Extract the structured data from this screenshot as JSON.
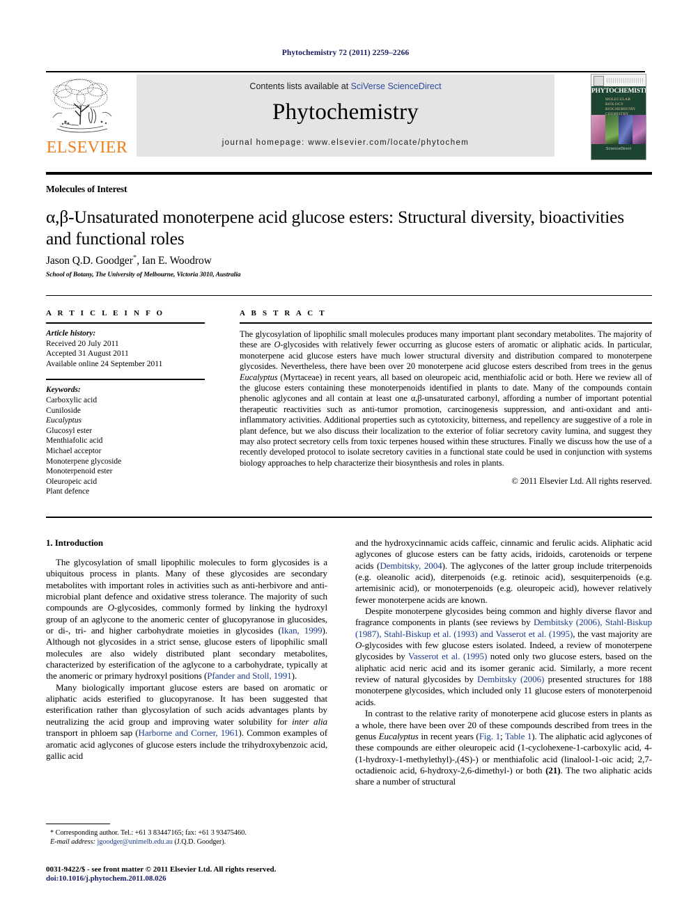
{
  "running_head": "Phytochemistry 72 (2011) 2259–2266",
  "masthead": {
    "publisher_name": "ELSEVIER",
    "contents_prefix": "Contents lists available at ",
    "contents_link": "SciVerse ScienceDirect",
    "journal_title": "Phytochemistry",
    "homepage": "journal homepage: www.elsevier.com/locate/phytochem",
    "cover": {
      "title": "PHYTOCHEMISTRY",
      "subtitle_lines": "MOLECULAR BIOLOGY\nBIOCHEMISTRY\nCHEMISTRY",
      "footer": "ScienceDirect"
    }
  },
  "article": {
    "section_label": "Molecules of Interest",
    "title": "α,β-Unsaturated monoterpene acid glucose esters: Structural diversity, bioactivities and functional roles",
    "authors": "Jason Q.D. Goodger",
    "authors_second": ", Ian E. Woodrow",
    "corresponding_marker": "*",
    "affiliation": "School of Botany, The University of Melbourne, Victoria 3010, Australia"
  },
  "article_info": {
    "heading": "A R T I C L E    I N F O",
    "history_label": "Article history:",
    "history": [
      "Received 20 July 2011",
      "Accepted 31 August 2011",
      "Available online 24 September 2011"
    ],
    "keywords_label": "Keywords:",
    "keywords": [
      "Carboxylic acid",
      "Cuniloside",
      "Eucalyptus",
      "Glucosyl ester",
      "Menthiafolic acid",
      "Michael acceptor",
      "Monoterpene glycoside",
      "Monoterpenoid ester",
      "Oleuropeic acid",
      "Plant defence"
    ],
    "keywords_italic_index": 2
  },
  "abstract": {
    "heading": "A B S T R A C T",
    "body_1": "The glycosylation of lipophilic small molecules produces many important plant secondary metabolites. The majority of these are ",
    "o_gly": "O",
    "body_2": "-glycosides with relatively fewer occurring as glucose esters of aromatic or aliphatic acids. In particular, monoterpene acid glucose esters have much lower structural diversity and distribution compared to monoterpene glycosides. Nevertheless, there have been over 20 monoterpene acid glucose esters described from trees in the genus ",
    "genus": "Eucalyptus",
    "body_3": " (Myrtaceae) in recent years, all based on oleuropeic acid, menthiafolic acid or both. Here we review all of the glucose esters containing these monoterpenoids identified in plants to date. Many of the compounds contain phenolic aglycones and all contain at least one α,β-unsaturated carbonyl, affording a number of important potential therapeutic reactivities such as anti-tumor promotion, carcinogenesis suppression, and anti-oxidant and anti-inflammatory activities. Additional properties such as cytotoxicity, bitterness, and repellency are suggestive of a role in plant defence, but we also discuss their localization to the exterior of foliar secretory cavity lumina, and suggest they may also protect secretory cells from toxic terpenes housed within these structures. Finally we discuss how the use of a recently developed protocol to isolate secretory cavities in a functional state could be used in conjunction with systems biology approaches to help characterize their biosynthesis and roles in plants.",
    "rights": "© 2011 Elsevier Ltd. All rights reserved."
  },
  "introduction": {
    "heading": "1. Introduction",
    "p1_a": "The glycosylation of small lipophilic molecules to form glycosides is a ubiquitous process in plants. Many of these glycosides are secondary metabolites with important roles in activities such as anti-herbivore and anti-microbial plant defence and oxidative stress tolerance. The majority of such compounds are ",
    "p1_o": "O",
    "p1_b": "-glycosides, commonly formed by linking the hydroxyl group of an aglycone to the anomeric center of glucopyranose in glucosides, or di-, tri- and higher carbohydrate moieties in glycosides (",
    "p1_cite1": "Ikan, 1999",
    "p1_c": "). Although not glycosides in a strict sense, glucose esters of lipophilic small molecules are also widely distributed plant secondary metabolites, characterized by esterification of the aglycone to a carbohydrate, typically at the anomeric or primary hydroxyl positions (",
    "p1_cite2": "Pfander and Stoll, 1991",
    "p1_d": ").",
    "p2_a": "Many biologically important glucose esters are based on aromatic or aliphatic acids esterified to glucopyranose. It has been suggested that esterification rather than glycosylation of such acids advantages plants by neutralizing the acid group and improving water solubility for ",
    "p2_italic": "inter alia",
    "p2_b": " transport in phloem sap (",
    "p2_cite1": "Harborne and Corner, 1961",
    "p2_c": "). Common examples of aromatic acid aglycones of glucose esters include the trihydroxybenzoic acid, gallic acid",
    "r1_a": "and the hydroxycinnamic acids caffeic, cinnamic and ferulic acids. Aliphatic acid aglycones of glucose esters can be fatty acids, iridoids, carotenoids or terpene acids (",
    "r1_cite": "Dembitsky, 2004",
    "r1_b": "). The aglycones of the latter group include triterpenoids (e.g. oleanolic acid), diterpenoids (e.g. retinoic acid), sesquiterpenoids (e.g. artemisinic acid), or monoterpenoids (e.g. oleuropeic acid), however relatively fewer monoterpene acids are known.",
    "r2_a": "Despite monoterpene glycosides being common and highly diverse flavor and fragrance components in plants (see reviews by ",
    "r2_cite1": "Dembitsky (2006), Stahl-Biskup (1987), Stahl-Biskup et al. (1993) and Vasserot et al. (1995)",
    "r2_b": ", the vast majority are ",
    "r2_o": "O",
    "r2_c": "-glycosides with few glucose esters isolated. Indeed, a review of monoterpene glycosides by ",
    "r2_cite2": "Vasserot et al. (1995)",
    "r2_d": " noted only two glucose esters, based on the aliphatic acid neric acid and its isomer geranic acid. Similarly, a more recent review of natural glycosides by ",
    "r2_cite3": "Dembitsky (2006)",
    "r2_e": " presented structures for 188 monoterpene glycosides, which included only 11 glucose esters of monoterpenoid acids.",
    "r3_a": "In contrast to the relative rarity of monoterpene acid glucose esters in plants as a whole, there have been over 20 of these compounds described from trees in the genus ",
    "r3_genus": "Eucalyptus",
    "r3_b": " in recent years (",
    "r3_cite1": "Fig. 1",
    "r3_c": "; ",
    "r3_cite2": "Table 1",
    "r3_d": "). The aliphatic acid aglycones of these compounds are either oleuropeic acid (1-cyclohexene-1-carboxylic acid, 4-(1-hydroxy-1-methylethyl)-,(4S)-) or menthiafolic acid (linalool-1-oic acid; 2,7-octadienoic acid, 6-hydroxy-2,6-dimethyl-) or both ",
    "r3_bold": "(21)",
    "r3_e": ". The two aliphatic acids share a number of structural"
  },
  "footnote": {
    "marker": "*",
    "corresponding": " Corresponding author. Tel.: +61 3 83447165; fax: +61 3 93475460.",
    "email_label": "E-mail address:",
    "email": "jgoodger@unimelb.edu.au",
    "email_suffix": " (J.Q.D. Goodger)."
  },
  "page_footer": {
    "issn_line": "0031-9422/$ - see front matter © 2011 Elsevier Ltd. All rights reserved.",
    "doi_prefix": "doi:",
    "doi": "10.1016/j.phytochem.2011.08.026"
  },
  "colors": {
    "link_blue": "#2b4a9b",
    "cite_blue": "#1a3a8f",
    "elsevier_orange": "#f07d1a",
    "cover_green": "#1d4430",
    "band_gray": "#e4e4e4"
  }
}
